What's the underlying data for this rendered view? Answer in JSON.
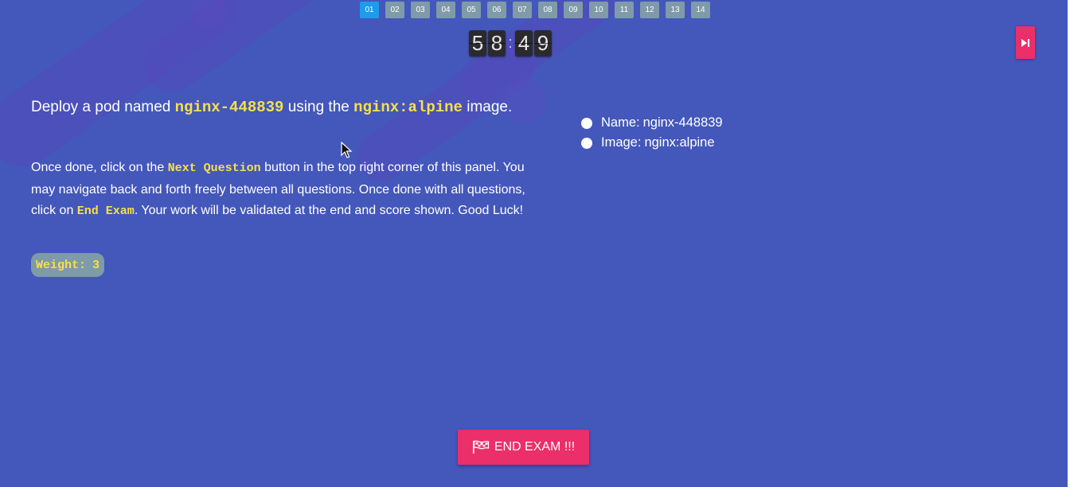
{
  "questions": [
    "01",
    "02",
    "03",
    "04",
    "05",
    "06",
    "07",
    "08",
    "09",
    "10",
    "11",
    "12",
    "13",
    "14"
  ],
  "active_question": "01",
  "timer": {
    "minutes_tens": "5",
    "minutes_ones": "8",
    "separator": ":",
    "seconds_tens": "4",
    "seconds_ones": "9"
  },
  "question": {
    "pre1": "Deploy a pod named ",
    "pod_name": "nginx-448839",
    "mid": " using the ",
    "image": "nginx:alpine",
    "post": " image."
  },
  "instructions": {
    "t1": "Once done, click on the ",
    "next_label": "Next Question",
    "t2": " button in the top right corner of this panel. You may navigate back and forth freely between all questions. Once done with all questions, click on ",
    "end_label": "End Exam",
    "t3": ". Your work will be validated at the end and score shown. Good Luck!"
  },
  "weight": {
    "label": "Weight:",
    "value": "3"
  },
  "checklist": [
    {
      "label": "Name:",
      "value": "nginx-448839"
    },
    {
      "label": "Image:",
      "value": "nginx:alpine"
    }
  ],
  "end_exam_button": "END EXAM !!!",
  "colors": {
    "background": "#4457bb",
    "accent": "#ea2f6b",
    "nav_active": "#1e9bea",
    "nav_inactive": "#7f9aa8",
    "code": "#f4e04d"
  },
  "icons": {
    "next": "skip-next-icon",
    "end": "flag-icon"
  }
}
